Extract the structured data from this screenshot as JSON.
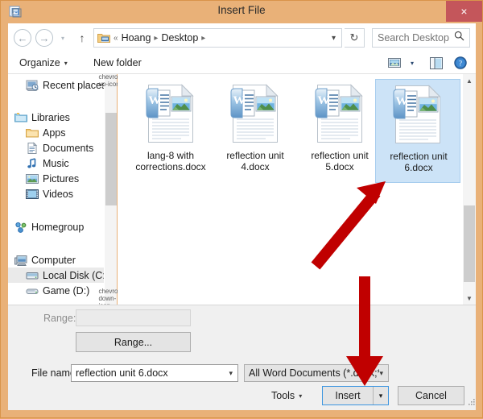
{
  "window": {
    "title": "Insert File",
    "app_icon": "document-window-icon",
    "close_label": "×",
    "frame_color": "#e9b178",
    "close_color": "#c4565b"
  },
  "navbar": {
    "back_icon": "arrow-left-icon",
    "forward_icon": "arrow-right-icon",
    "recent_icon": "chevron-down-icon",
    "up_icon": "arrow-up-icon",
    "breadcrumb": {
      "folder_icon": "folder-desktop-icon",
      "prefix": "«",
      "items": [
        "Hoang",
        "Desktop"
      ],
      "separator": "▸",
      "dropdown_icon": "chevron-down-icon"
    },
    "refresh_icon": "refresh-icon",
    "search": {
      "placeholder": "Search Desktop",
      "value": "",
      "icon": "search-icon"
    }
  },
  "toolbar": {
    "organize_label": "Organize",
    "organize_caret": "▾",
    "new_folder_label": "New folder",
    "view_icon": "view-options-icon",
    "view_caret": "▾",
    "panes_icon": "preview-pane-icon",
    "help_icon": "help-icon"
  },
  "sidebar": {
    "items": [
      {
        "label": "Recent places",
        "icon": "recent-places-icon",
        "indent": 1,
        "selected": false
      },
      {
        "label": "Libraries",
        "icon": "libraries-icon",
        "indent": 0,
        "selected": false
      },
      {
        "label": "Apps",
        "icon": "folder-icon",
        "indent": 1,
        "selected": false
      },
      {
        "label": "Documents",
        "icon": "documents-icon",
        "indent": 1,
        "selected": false
      },
      {
        "label": "Music",
        "icon": "music-icon",
        "indent": 1,
        "selected": false
      },
      {
        "label": "Pictures",
        "icon": "pictures-icon",
        "indent": 1,
        "selected": false
      },
      {
        "label": "Videos",
        "icon": "videos-icon",
        "indent": 1,
        "selected": false
      },
      {
        "label": "Homegroup",
        "icon": "homegroup-icon",
        "indent": 0,
        "selected": false
      },
      {
        "label": "Computer",
        "icon": "computer-icon",
        "indent": 0,
        "selected": false
      },
      {
        "label": "Local Disk (C:)",
        "icon": "hard-disk-icon",
        "indent": 1,
        "selected": true
      },
      {
        "label": "Game (D:)",
        "icon": "drive-icon",
        "indent": 1,
        "selected": false
      }
    ],
    "scroll_up_icon": "chevron-up-icon",
    "scroll_down_icon": "chevron-down-icon"
  },
  "filelist": {
    "files": [
      {
        "name": "lang-8 with corrections.docx",
        "icon": "word-document-icon",
        "selected": false
      },
      {
        "name": "reflection unit 4.docx",
        "icon": "word-document-icon",
        "selected": false
      },
      {
        "name": "reflection unit 5.docx",
        "icon": "word-document-icon",
        "selected": false
      },
      {
        "name": "reflection unit 6.docx",
        "icon": "word-document-icon",
        "selected": true
      }
    ],
    "scroll_up_icon": "chevron-up-icon",
    "scroll_down_icon": "chevron-down-icon",
    "selection_color": "#cce3f7"
  },
  "form": {
    "range_label": "Range:",
    "range_value": "",
    "range_button_label": "Range...",
    "filename_label": "File name:",
    "filename_value": "reflection unit 6.docx",
    "filename_caret": "▾",
    "filter_value": "All Word Documents (*.docx;*.d",
    "filter_caret": "▾",
    "tools_label": "Tools",
    "tools_caret": "▾",
    "insert_label": "Insert",
    "insert_caret": "▾",
    "cancel_label": "Cancel",
    "resize_grip_icon": "resize-grip-icon"
  },
  "annotations": {
    "color": "#c00000",
    "arrows": [
      {
        "name": "arrow-to-selected-file",
        "target": "reflection unit 6.docx"
      },
      {
        "name": "arrow-to-insert-button",
        "target": "Insert"
      }
    ]
  }
}
